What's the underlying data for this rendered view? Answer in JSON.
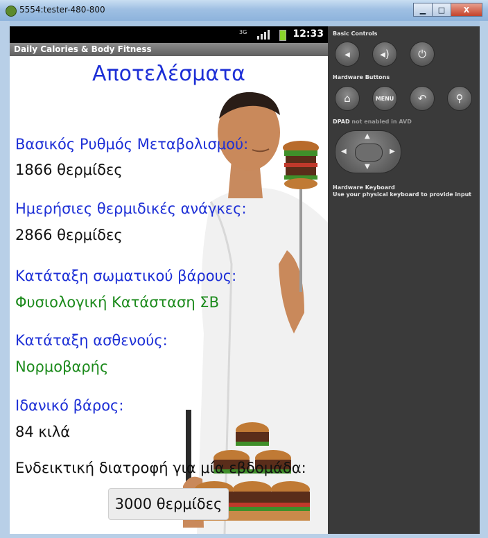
{
  "window": {
    "title": "5554:tester-480-800",
    "minimize_glyph": "▁",
    "maximize_glyph": "□",
    "close_glyph": "X"
  },
  "statusbar": {
    "network": "3G",
    "time": "12:33"
  },
  "app": {
    "title": "Daily Calories & Body Fitness"
  },
  "results": {
    "heading": "Αποτελέσματα",
    "bmr_label": "Βασικός Ρυθμός Μεταβολισμού:",
    "bmr_value": "1866 θερμίδες",
    "daily_label": "Ημερήσιες θερμιδικές ανάγκες:",
    "daily_value": "2866 θερμίδες",
    "weight_class_label": "Κατάταξη σωματικού βάρους:",
    "weight_class_value": "Φυσιολογική Κατάσταση ΣΒ",
    "patient_class_label": "Κατάταξη ασθενούς:",
    "patient_class_value": "Νορμοβαρής",
    "ideal_weight_label": "Ιδανικό βάρος:",
    "ideal_weight_value": "84 κιλά",
    "diet_label": "Ενδεικτική διατροφή για μία εβδομάδα:",
    "diet_button": "3000 θερμίδες"
  },
  "emulator_panel": {
    "basic_controls_label": "Basic Controls",
    "hardware_buttons_label": "Hardware Buttons",
    "dpad_label": "DPAD",
    "dpad_note": "not enabled in AVD",
    "keyboard_label": "Hardware Keyboard",
    "keyboard_note": "Use your physical keyboard to provide input",
    "menu_button": "MENU",
    "icons": [
      "volume-down-icon",
      "volume-up-icon",
      "power-icon",
      "home-icon",
      "menu-icon",
      "back-icon",
      "search-icon"
    ]
  },
  "colors": {
    "label_blue": "#1d2fd6",
    "value_green": "#1b8a1b",
    "panel_bg": "#3a3a3a"
  }
}
